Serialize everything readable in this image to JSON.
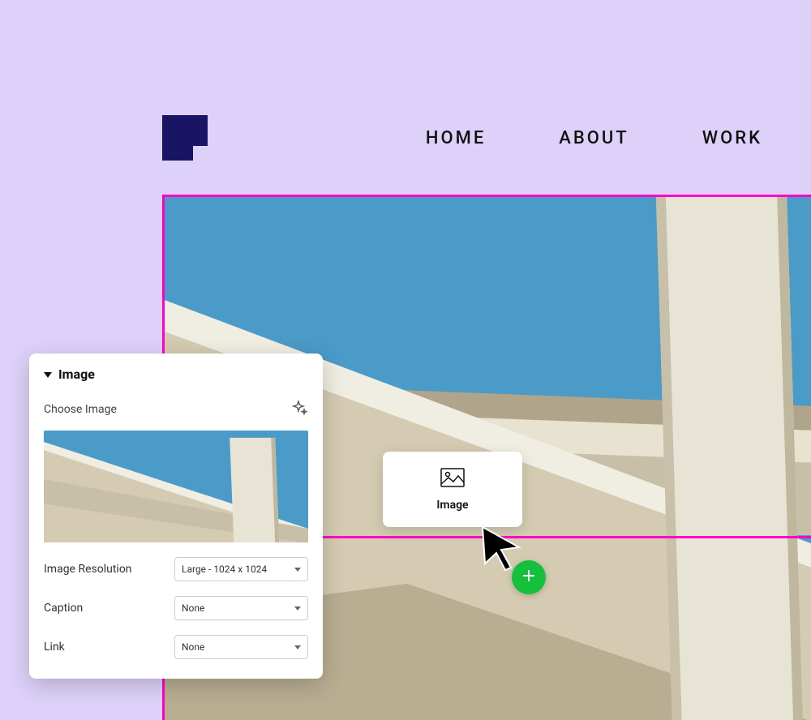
{
  "nav": {
    "home": "HOME",
    "about": "ABOUT",
    "work": "WORK"
  },
  "tooltip": {
    "label": "Image"
  },
  "panel": {
    "title": "Image",
    "choose_label": "Choose Image",
    "resolution_label": "Image Resolution",
    "resolution_value": "Large - 1024 x 1024",
    "caption_label": "Caption",
    "caption_value": "None",
    "link_label": "Link",
    "link_value": "None"
  },
  "colors": {
    "accent": "#FF00C8",
    "add": "#14C03C",
    "bg": "#DDD1F9",
    "logo": "#1A1464"
  }
}
